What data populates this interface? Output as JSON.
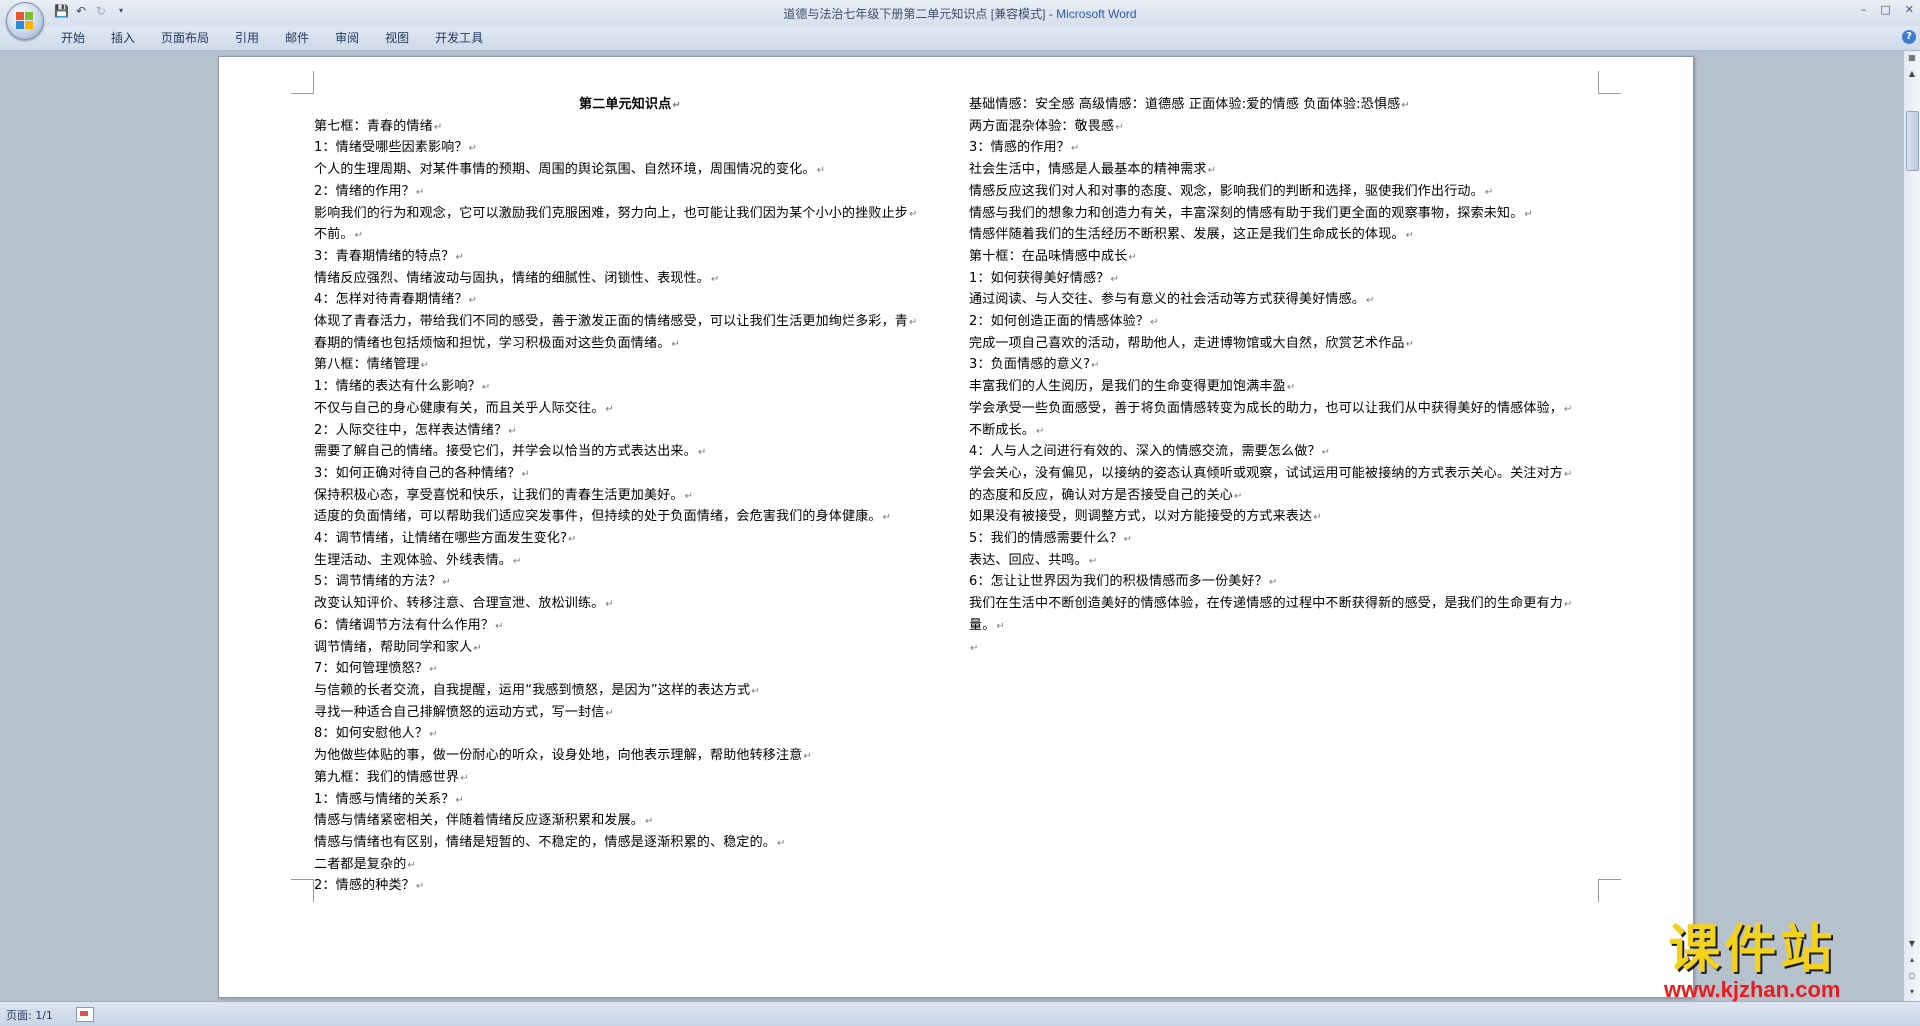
{
  "window": {
    "doc_title": "道德与法治七年级下册第二单元知识点 [兼容模式]",
    "app_name": "Microsoft Word"
  },
  "ribbon": {
    "tabs": [
      "开始",
      "插入",
      "页面布局",
      "引用",
      "邮件",
      "审阅",
      "视图",
      "开发工具"
    ]
  },
  "document": {
    "left_column": [
      "第二单元知识点",
      "第七框：青春的情绪",
      "1：情绪受哪些因素影响？",
      "个人的生理周期、对某件事情的预期、周围的舆论氛围、自然环境，周围情况的变化。",
      "2：情绪的作用？",
      "影响我们的行为和观念，它可以激励我们克服困难，努力向上，也可能让我们因为某个小小的挫败止步",
      "不前。",
      "3：青春期情绪的特点？",
      "情绪反应强烈、情绪波动与固执，情绪的细腻性、闭锁性、表现性。",
      "4：怎样对待青春期情绪？",
      "体现了青春活力，带给我们不同的感受，善于激发正面的情绪感受，可以让我们生活更加绚烂多彩，青",
      "春期的情绪也包括烦恼和担忧，学习积极面对这些负面情绪。",
      "第八框：情绪管理",
      "1：情绪的表达有什么影响？",
      "不仅与自己的身心健康有关，而且关乎人际交往。",
      "2：人际交往中，怎样表达情绪？",
      "需要了解自己的情绪。接受它们，并学会以恰当的方式表达出来。",
      "3：如何正确对待自己的各种情绪？",
      "保持积极心态，享受喜悦和快乐，让我们的青春生活更加美好。",
      "适度的负面情绪，可以帮助我们适应突发事件，但持续的处于负面情绪，会危害我们的身体健康。",
      "4：调节情绪，让情绪在哪些方面发生变化?",
      "生理活动、主观体验、外线表情。",
      "5：调节情绪的方法？",
      "改变认知评价、转移注意、合理宣泄、放松训练。",
      "6：情绪调节方法有什么作用？",
      "调节情绪，帮助同学和家人",
      "7：如何管理愤怒？",
      "与信赖的长者交流，自我提醒，运用“我感到愤怒，是因为”这样的表达方式",
      "寻找一种适合自己排解愤怒的运动方式，写一封信",
      "8：如何安慰他人？",
      "为他做些体贴的事，做一份耐心的听众，设身处地，向他表示理解，帮助他转移注意",
      "第九框：我们的情感世界",
      "1：情感与情绪的关系？",
      "情感与情绪紧密相关，伴随着情绪反应逐渐积累和发展。",
      "情感与情绪也有区别，情绪是短暂的、不稳定的，情感是逐渐积累的、稳定的。",
      "二者都是复杂的",
      "2：情感的种类？"
    ],
    "right_column": [
      "基础情感：安全感 高级情感：道德感 正面体验:爱的情感 负面体验:恐惧感",
      "两方面混杂体验：敬畏感",
      "3：情感的作用？",
      "社会生活中，情感是人最基本的精神需求",
      "情感反应这我们对人和对事的态度、观念，影响我们的判断和选择，驱使我们作出行动。",
      "情感与我们的想象力和创造力有关，丰富深刻的情感有助于我们更全面的观察事物，探索未知。",
      "情感伴随着我们的生活经历不断积累、发展，这正是我们生命成长的体现。",
      "第十框：在品味情感中成长",
      "1：如何获得美好情感？",
      "通过阅读、与人交往、参与有意义的社会活动等方式获得美好情感。",
      "2：如何创造正面的情感体验？",
      "完成一项自己喜欢的活动，帮助他人，走进博物馆或大自然，欣赏艺术作品",
      "3：负面情感的意义?",
      "丰富我们的人生阅历，是我们的生命变得更加饱满丰盈",
      "学会承受一些负面感受，善于将负面情感转变为成长的助力，也可以让我们从中获得美好的情感体验，",
      "不断成长。",
      "4：人与人之间进行有效的、深入的情感交流，需要怎么做？",
      "学会关心，没有偏见，以接纳的姿态认真倾听或观察，试试运用可能被接纳的方式表示关心。关注对方",
      "的态度和反应，确认对方是否接受自己的关心",
      "如果没有被接受，则调整方式，以对方能接受的方式来表达",
      "5：我们的情感需要什么？",
      "表达、回应、共鸣。",
      "6：怎让让世界因为我们的积极情感而多一份美好？",
      "我们在生活中不断创造美好的情感体验，在传递情感的过程中不断获得新的感受，是我们的生命更有力",
      "量。",
      ""
    ]
  },
  "statusbar": {
    "page_info": "页面: 1/1"
  },
  "watermark": {
    "brand": "课件站",
    "url": "www.kjzhan.com"
  },
  "colors": {
    "watermark_yellow": "#f2d21a",
    "watermark_red": "#e81c1c",
    "app_name_blue": "#2a5aa8"
  }
}
